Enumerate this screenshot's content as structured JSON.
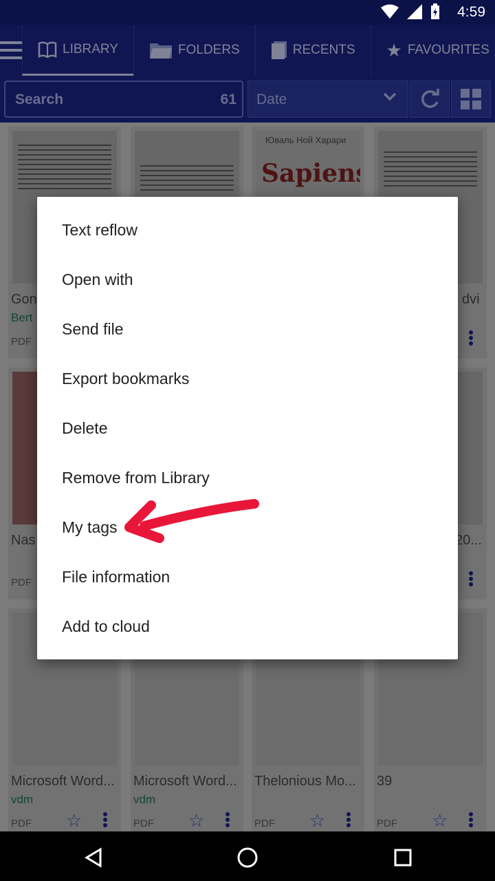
{
  "status": {
    "time": "4:59"
  },
  "tabs": [
    {
      "label": "LIBRARY",
      "icon": "book-icon",
      "active": true
    },
    {
      "label": "FOLDERS",
      "icon": "folder-icon"
    },
    {
      "label": "RECENTS",
      "icon": "recents-icon"
    },
    {
      "label": "FAVOURITES",
      "icon": "star-icon"
    }
  ],
  "toolbar": {
    "search_label": "Search",
    "count": "61",
    "sort_label": "Date"
  },
  "cards": [
    {
      "title": "Gon",
      "author": "Bert",
      "type": "PDF",
      "thumb_text": ""
    },
    {
      "title": "",
      "author": "",
      "type": "",
      "thumb_text": ""
    },
    {
      "title": "",
      "author": "",
      "type": "",
      "thumb_text": "Sapiens",
      "thumb_sub": "Юваль Ной Харари"
    },
    {
      "title": "dvi",
      "author": "",
      "type": "",
      "thumb_text": ""
    },
    {
      "title": "Nas",
      "author": "",
      "type": "PDF",
      "thumb_text": ""
    },
    {
      "title": "20...",
      "author": "",
      "type": "",
      "thumb_text": ""
    },
    {
      "title": "Microsoft Word...",
      "author": "vdm",
      "type": "PDF"
    },
    {
      "title": "Microsoft Word...",
      "author": "vdm",
      "type": "PDF"
    },
    {
      "title": "Thelonious Mo...",
      "author": "",
      "type": "PDF"
    },
    {
      "title": "39",
      "author": "",
      "type": "PDF"
    }
  ],
  "menu": {
    "items": [
      "Text reflow",
      "Open with",
      "Send file",
      "Export bookmarks",
      "Delete",
      "Remove from Library",
      "My tags",
      "File information",
      "Add to cloud"
    ]
  },
  "colors": {
    "appbar": "#1a237e",
    "statusbar": "#0b1248",
    "accent_arrow": "#e8173a"
  }
}
